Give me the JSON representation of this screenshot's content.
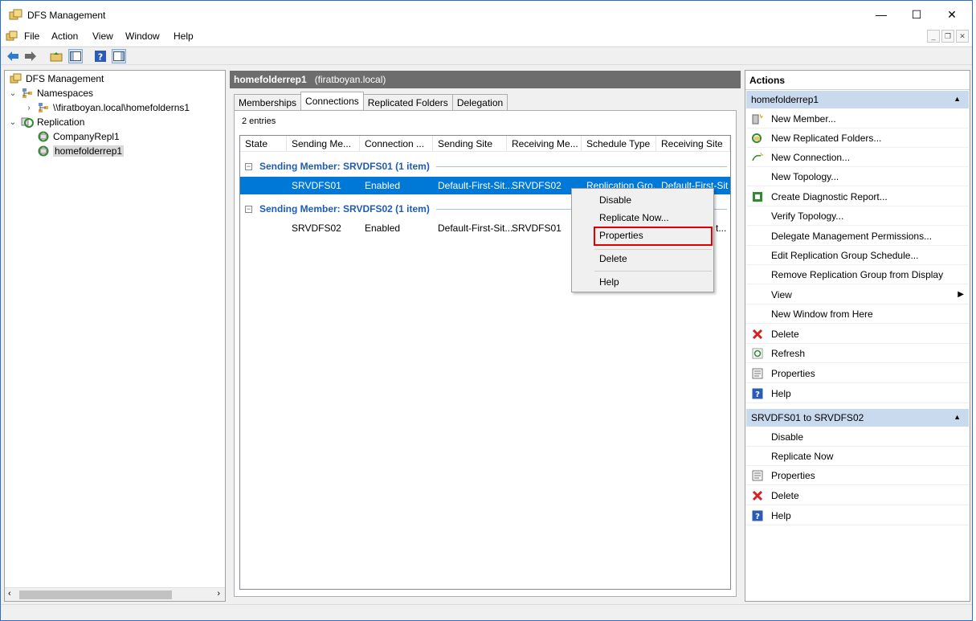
{
  "window": {
    "title": "DFS Management",
    "minimize": "—",
    "maximize": "☐",
    "close": "✕"
  },
  "menu": {
    "items": [
      "File",
      "Action",
      "View",
      "Window",
      "Help"
    ]
  },
  "tree": {
    "root": "DFS Management",
    "namespaces": "Namespaces",
    "namespace_item": "\\\\firatboyan.local\\homefolderns1",
    "replication": "Replication",
    "group1": "CompanyRepl1",
    "group2": "homefolderrep1"
  },
  "center": {
    "title": "homefolderrep1",
    "domain": "(firatboyan.local)",
    "tabs": [
      "Memberships",
      "Connections",
      "Replicated Folders",
      "Delegation"
    ],
    "entries": "2 entries",
    "columns": [
      "State",
      "Sending Me...",
      "Connection ...",
      "Sending Site",
      "Receiving Me...",
      "Schedule Type",
      "Receiving Site"
    ],
    "groups": [
      {
        "label": "Sending Member: SRVDFS01 (1 item)",
        "row": {
          "sending": "SRVDFS01",
          "connection": "Enabled",
          "sending_site": "Default-First-Sit...",
          "receiving": "SRVDFS02",
          "schedule": "Replication Gro...",
          "receiving_site": "Default-First-Sit..."
        }
      },
      {
        "label": "Sending Member: SRVDFS02 (1 item)",
        "row": {
          "sending": "SRVDFS02",
          "connection": "Enabled",
          "sending_site": "Default-First-Sit...",
          "receiving": "SRVDFS01",
          "schedule": "",
          "receiving_site": "t..."
        }
      }
    ]
  },
  "context_menu": {
    "disable": "Disable",
    "replicate_now": "Replicate Now...",
    "properties": "Properties",
    "delete": "Delete",
    "help": "Help"
  },
  "actions": {
    "header": "Actions",
    "section1": {
      "title": "homefolderrep1",
      "items": [
        "New Member...",
        "New Replicated Folders...",
        "New Connection...",
        "New Topology...",
        "Create Diagnostic Report...",
        "Verify Topology...",
        "Delegate Management Permissions...",
        "Edit Replication Group Schedule...",
        "Remove Replication Group from Display",
        "View",
        "New Window from Here",
        "Delete",
        "Refresh",
        "Properties",
        "Help"
      ]
    },
    "section2": {
      "title": "SRVDFS01 to SRVDFS02",
      "items": [
        "Disable",
        "Replicate Now",
        "Properties",
        "Delete",
        "Help"
      ]
    }
  },
  "colors": {
    "selection": "#0078d7",
    "group_text": "#1e5cb3",
    "section_bg": "#c9d9ee",
    "highlight_box": "#e00000"
  }
}
